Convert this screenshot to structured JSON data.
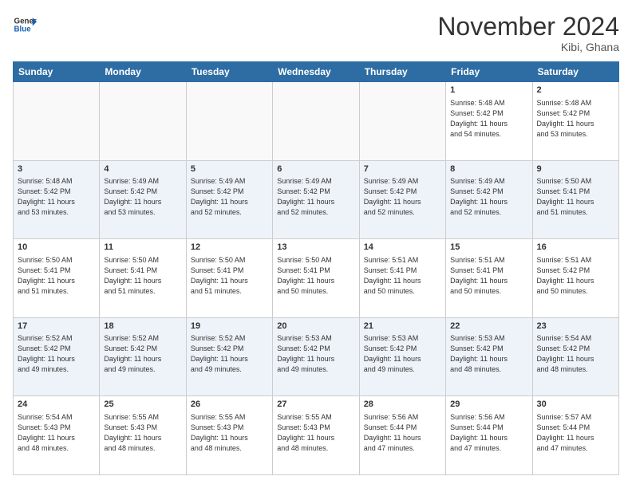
{
  "header": {
    "logo_line1": "General",
    "logo_line2": "Blue",
    "month": "November 2024",
    "location": "Kibi, Ghana"
  },
  "weekdays": [
    "Sunday",
    "Monday",
    "Tuesday",
    "Wednesday",
    "Thursday",
    "Friday",
    "Saturday"
  ],
  "weeks": [
    [
      {
        "day": "",
        "info": ""
      },
      {
        "day": "",
        "info": ""
      },
      {
        "day": "",
        "info": ""
      },
      {
        "day": "",
        "info": ""
      },
      {
        "day": "",
        "info": ""
      },
      {
        "day": "1",
        "info": "Sunrise: 5:48 AM\nSunset: 5:42 PM\nDaylight: 11 hours\nand 54 minutes."
      },
      {
        "day": "2",
        "info": "Sunrise: 5:48 AM\nSunset: 5:42 PM\nDaylight: 11 hours\nand 53 minutes."
      }
    ],
    [
      {
        "day": "3",
        "info": "Sunrise: 5:48 AM\nSunset: 5:42 PM\nDaylight: 11 hours\nand 53 minutes."
      },
      {
        "day": "4",
        "info": "Sunrise: 5:49 AM\nSunset: 5:42 PM\nDaylight: 11 hours\nand 53 minutes."
      },
      {
        "day": "5",
        "info": "Sunrise: 5:49 AM\nSunset: 5:42 PM\nDaylight: 11 hours\nand 52 minutes."
      },
      {
        "day": "6",
        "info": "Sunrise: 5:49 AM\nSunset: 5:42 PM\nDaylight: 11 hours\nand 52 minutes."
      },
      {
        "day": "7",
        "info": "Sunrise: 5:49 AM\nSunset: 5:42 PM\nDaylight: 11 hours\nand 52 minutes."
      },
      {
        "day": "8",
        "info": "Sunrise: 5:49 AM\nSunset: 5:42 PM\nDaylight: 11 hours\nand 52 minutes."
      },
      {
        "day": "9",
        "info": "Sunrise: 5:50 AM\nSunset: 5:41 PM\nDaylight: 11 hours\nand 51 minutes."
      }
    ],
    [
      {
        "day": "10",
        "info": "Sunrise: 5:50 AM\nSunset: 5:41 PM\nDaylight: 11 hours\nand 51 minutes."
      },
      {
        "day": "11",
        "info": "Sunrise: 5:50 AM\nSunset: 5:41 PM\nDaylight: 11 hours\nand 51 minutes."
      },
      {
        "day": "12",
        "info": "Sunrise: 5:50 AM\nSunset: 5:41 PM\nDaylight: 11 hours\nand 51 minutes."
      },
      {
        "day": "13",
        "info": "Sunrise: 5:50 AM\nSunset: 5:41 PM\nDaylight: 11 hours\nand 50 minutes."
      },
      {
        "day": "14",
        "info": "Sunrise: 5:51 AM\nSunset: 5:41 PM\nDaylight: 11 hours\nand 50 minutes."
      },
      {
        "day": "15",
        "info": "Sunrise: 5:51 AM\nSunset: 5:41 PM\nDaylight: 11 hours\nand 50 minutes."
      },
      {
        "day": "16",
        "info": "Sunrise: 5:51 AM\nSunset: 5:42 PM\nDaylight: 11 hours\nand 50 minutes."
      }
    ],
    [
      {
        "day": "17",
        "info": "Sunrise: 5:52 AM\nSunset: 5:42 PM\nDaylight: 11 hours\nand 49 minutes."
      },
      {
        "day": "18",
        "info": "Sunrise: 5:52 AM\nSunset: 5:42 PM\nDaylight: 11 hours\nand 49 minutes."
      },
      {
        "day": "19",
        "info": "Sunrise: 5:52 AM\nSunset: 5:42 PM\nDaylight: 11 hours\nand 49 minutes."
      },
      {
        "day": "20",
        "info": "Sunrise: 5:53 AM\nSunset: 5:42 PM\nDaylight: 11 hours\nand 49 minutes."
      },
      {
        "day": "21",
        "info": "Sunrise: 5:53 AM\nSunset: 5:42 PM\nDaylight: 11 hours\nand 49 minutes."
      },
      {
        "day": "22",
        "info": "Sunrise: 5:53 AM\nSunset: 5:42 PM\nDaylight: 11 hours\nand 48 minutes."
      },
      {
        "day": "23",
        "info": "Sunrise: 5:54 AM\nSunset: 5:42 PM\nDaylight: 11 hours\nand 48 minutes."
      }
    ],
    [
      {
        "day": "24",
        "info": "Sunrise: 5:54 AM\nSunset: 5:43 PM\nDaylight: 11 hours\nand 48 minutes."
      },
      {
        "day": "25",
        "info": "Sunrise: 5:55 AM\nSunset: 5:43 PM\nDaylight: 11 hours\nand 48 minutes."
      },
      {
        "day": "26",
        "info": "Sunrise: 5:55 AM\nSunset: 5:43 PM\nDaylight: 11 hours\nand 48 minutes."
      },
      {
        "day": "27",
        "info": "Sunrise: 5:55 AM\nSunset: 5:43 PM\nDaylight: 11 hours\nand 48 minutes."
      },
      {
        "day": "28",
        "info": "Sunrise: 5:56 AM\nSunset: 5:44 PM\nDaylight: 11 hours\nand 47 minutes."
      },
      {
        "day": "29",
        "info": "Sunrise: 5:56 AM\nSunset: 5:44 PM\nDaylight: 11 hours\nand 47 minutes."
      },
      {
        "day": "30",
        "info": "Sunrise: 5:57 AM\nSunset: 5:44 PM\nDaylight: 11 hours\nand 47 minutes."
      }
    ]
  ]
}
